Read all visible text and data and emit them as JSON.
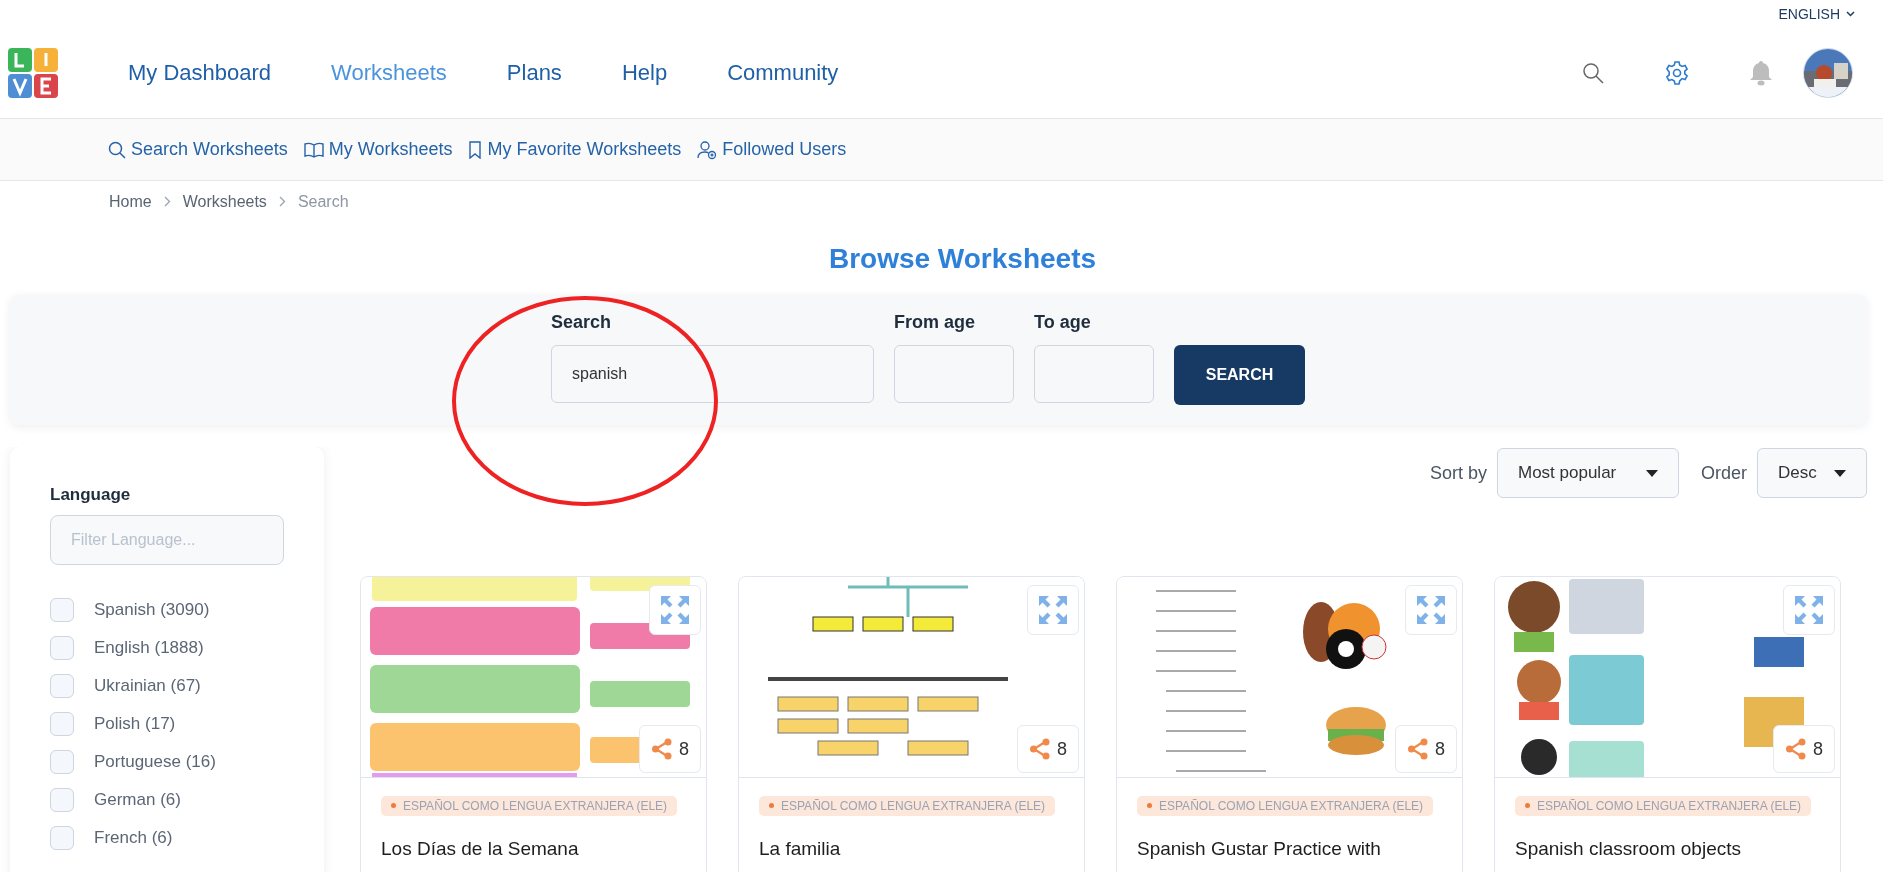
{
  "language_switch": "ENGLISH",
  "nav": [
    {
      "label": "My Dashboard",
      "selected": false
    },
    {
      "label": "Worksheets",
      "selected": true
    },
    {
      "label": "Plans",
      "selected": false
    },
    {
      "label": "Help",
      "selected": false
    },
    {
      "label": "Community",
      "selected": false
    }
  ],
  "subnav": [
    {
      "label": "Search Worksheets",
      "kind": "search"
    },
    {
      "label": "My Worksheets",
      "kind": "book"
    },
    {
      "label": "My Favorite Worksheets",
      "kind": "bookmark"
    },
    {
      "label": "Followed Users",
      "kind": "user"
    }
  ],
  "breadcrumb": [
    {
      "label": "Home",
      "current": false
    },
    {
      "label": "Worksheets",
      "current": false
    },
    {
      "label": "Search",
      "current": true
    }
  ],
  "page_title": "Browse Worksheets",
  "search_form": {
    "fields": [
      {
        "label": "Search",
        "value": "spanish"
      },
      {
        "label": "From age"
      },
      {
        "label": "To age"
      }
    ],
    "button": "SEARCH"
  },
  "sort": {
    "label": "Sort by",
    "value": "Most popular"
  },
  "order": {
    "label": "Order",
    "value": "Desc"
  },
  "filters": {
    "title": "Language",
    "placeholder": "Filter Language...",
    "options": [
      {
        "label": "Spanish (3090)",
        "checked": false
      },
      {
        "label": "English (1888)",
        "checked": false
      },
      {
        "label": "Ukrainian (67)",
        "checked": false
      },
      {
        "label": "Polish (17)",
        "checked": false
      },
      {
        "label": "Portuguese (16)",
        "checked": false
      },
      {
        "label": "German (6)",
        "checked": false
      },
      {
        "label": "French (6)",
        "checked": false
      }
    ]
  },
  "cards": [
    {
      "tag": "ESPAÑOL COMO LENGUA EXTRANJERA (ELE)",
      "title": "Los Días de la Semana",
      "shares": "8"
    },
    {
      "tag": "ESPAÑOL COMO LENGUA EXTRANJERA (ELE)",
      "title": "La familia",
      "shares": "8"
    },
    {
      "tag": "ESPAÑOL COMO LENGUA EXTRANJERA (ELE)",
      "title": "Spanish Gustar Practice with",
      "shares": "8"
    },
    {
      "tag": "ESPAÑOL COMO LENGUA EXTRANJERA (ELE)",
      "title": "Spanish classroom objects",
      "shares": "8"
    }
  ]
}
